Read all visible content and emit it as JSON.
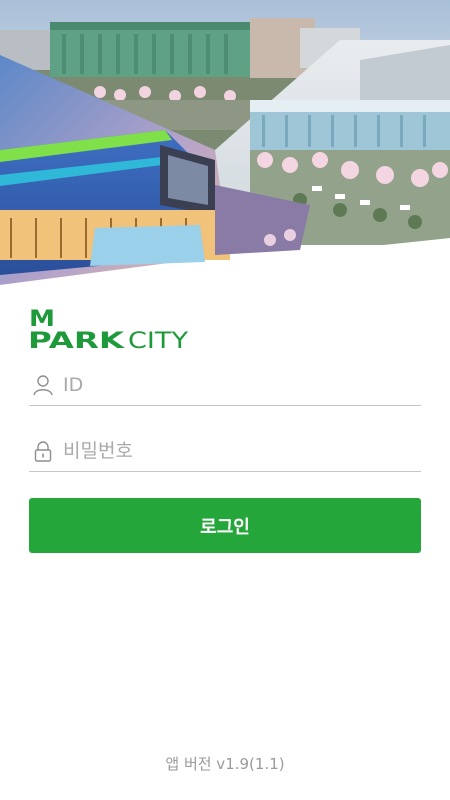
{
  "brand": {
    "logo_top": "M",
    "logo_park": "PARK",
    "logo_city": "CITY",
    "color": "#1e9a3a"
  },
  "login_form": {
    "id_placeholder": "ID",
    "password_placeholder": "비밀번호",
    "login_label": "로그인",
    "button_color": "#25a63a"
  },
  "footer": {
    "version_text": "앱 버전 v1.9(1.1)"
  }
}
